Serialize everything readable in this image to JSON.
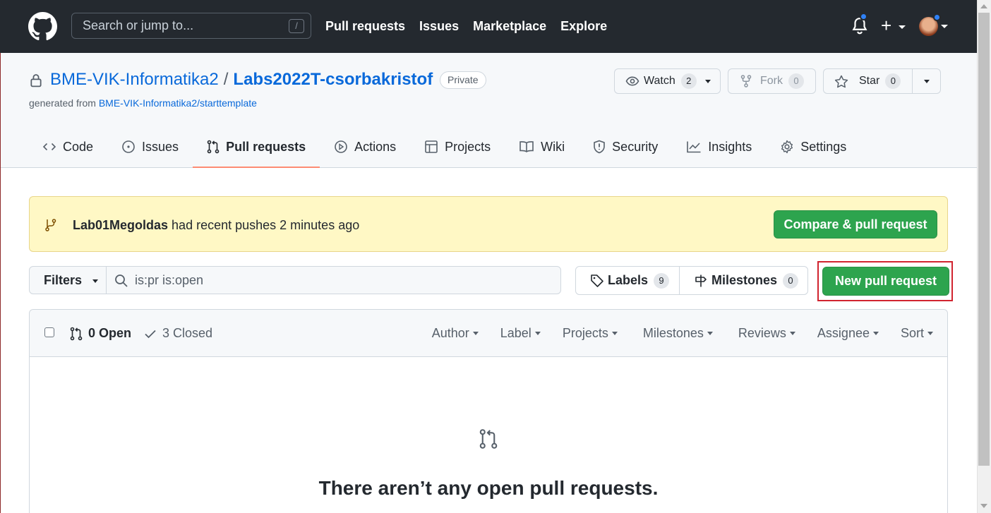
{
  "header": {
    "search_placeholder": "Search or jump to...",
    "slash_key": "/",
    "nav": [
      "Pull requests",
      "Issues",
      "Marketplace",
      "Explore"
    ],
    "plus": "+"
  },
  "repo": {
    "owner": "BME-VIK-Informatika2",
    "separator": "/",
    "name": "Labs2022T-csorbakristof",
    "visibility": "Private",
    "generated_prefix": "generated from ",
    "template_link": "BME-VIK-Informatika2/starttemplate",
    "watch": {
      "label": "Watch",
      "count": "2"
    },
    "fork": {
      "label": "Fork",
      "count": "0"
    },
    "star": {
      "label": "Star",
      "count": "0"
    }
  },
  "tabs": [
    {
      "label": "Code",
      "icon": "code-icon"
    },
    {
      "label": "Issues",
      "icon": "issue-opened-icon"
    },
    {
      "label": "Pull requests",
      "icon": "git-pull-request-icon",
      "selected": true
    },
    {
      "label": "Actions",
      "icon": "play-icon"
    },
    {
      "label": "Projects",
      "icon": "table-icon"
    },
    {
      "label": "Wiki",
      "icon": "book-icon"
    },
    {
      "label": "Security",
      "icon": "shield-icon"
    },
    {
      "label": "Insights",
      "icon": "graph-icon"
    },
    {
      "label": "Settings",
      "icon": "gear-icon"
    }
  ],
  "banner": {
    "branch": "Lab01Megoldas",
    "text": " had recent pushes 2 minutes ago",
    "button": "Compare & pull request"
  },
  "filterbar": {
    "filters_label": "Filters",
    "query": "is:pr is:open",
    "labels": {
      "label": "Labels",
      "count": "9"
    },
    "milestones": {
      "label": "Milestones",
      "count": "0"
    },
    "new_pr": "New pull request"
  },
  "list": {
    "open": "0 Open",
    "closed": "3 Closed",
    "sorts": [
      "Author",
      "Label",
      "Projects",
      "Milestones",
      "Reviews",
      "Assignee",
      "Sort"
    ],
    "blank_title": "There aren’t any open pull requests."
  },
  "colors": {
    "header_bg": "#24292f",
    "accent_green": "#2da44e",
    "link": "#0969da",
    "tab_underline": "#fd8c73",
    "highlight": "#d1242f"
  }
}
